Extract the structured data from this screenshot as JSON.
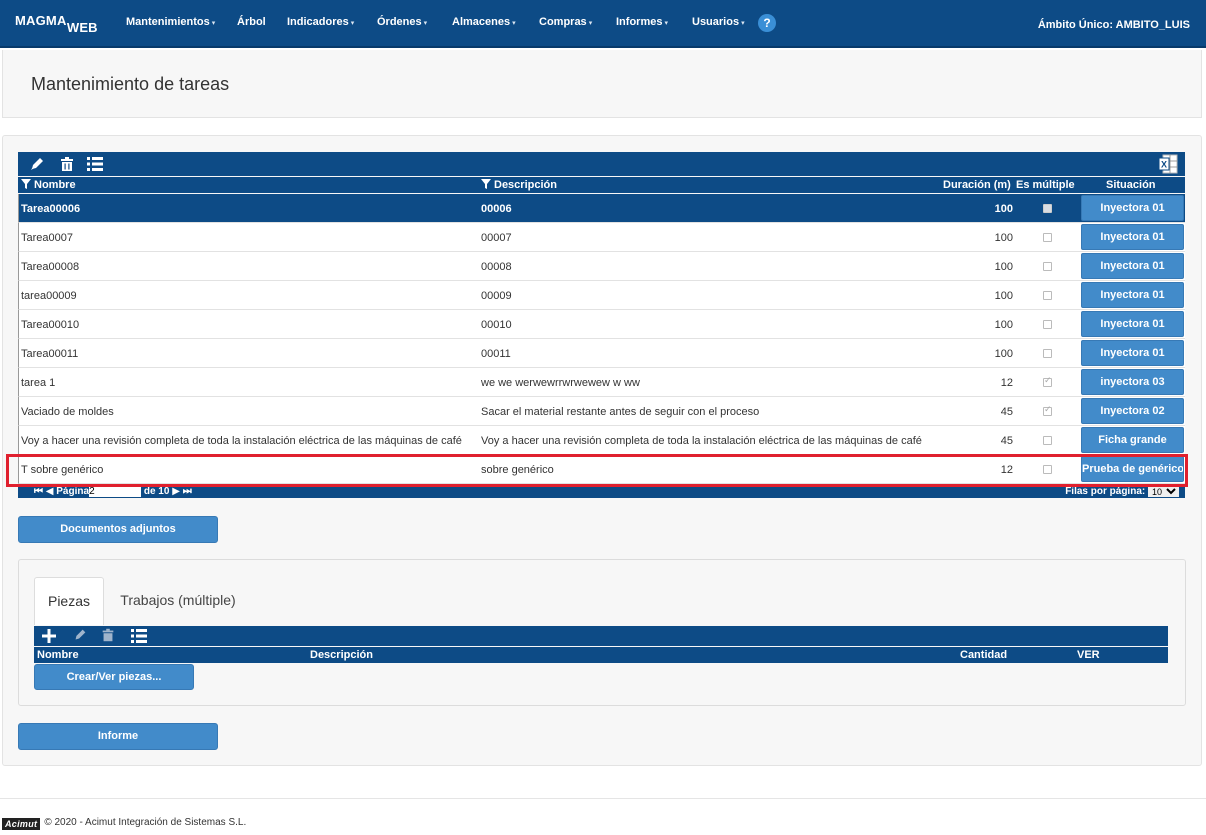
{
  "app": {
    "logo_main": "MAGMA",
    "logo_sub": "WEB",
    "ambito": "Ámbito Único: AMBITO_LUIS"
  },
  "nav": {
    "items": [
      {
        "label": "Mantenimientos",
        "has_caret": true
      },
      {
        "label": "Árbol",
        "has_caret": false
      },
      {
        "label": "Indicadores",
        "has_caret": true
      },
      {
        "label": "Órdenes",
        "has_caret": true
      },
      {
        "label": "Almacenes",
        "has_caret": true
      },
      {
        "label": "Compras",
        "has_caret": true
      },
      {
        "label": "Informes",
        "has_caret": true
      },
      {
        "label": "Usuarios",
        "has_caret": true
      }
    ],
    "help": "?"
  },
  "page": {
    "title": "Mantenimiento de tareas"
  },
  "grid": {
    "toolbar_icons": [
      "edit-icon",
      "trash-icon",
      "list-icon",
      "excel-icon"
    ],
    "columns": {
      "nombre": "Nombre",
      "descripcion": "Descripción",
      "duracion": "Duración (m)",
      "multiple": "Es múltiple",
      "situacion": "Situación"
    },
    "rows": [
      {
        "nombre": "Tarea00006",
        "descripcion": "00006",
        "duracion": "100",
        "multiple": false,
        "situacion": "Inyectora 01",
        "selected": true
      },
      {
        "nombre": "Tarea0007",
        "descripcion": "00007",
        "duracion": "100",
        "multiple": false,
        "situacion": "Inyectora 01",
        "selected": false
      },
      {
        "nombre": "Tarea00008",
        "descripcion": "00008",
        "duracion": "100",
        "multiple": false,
        "situacion": "Inyectora 01",
        "selected": false
      },
      {
        "nombre": "tarea00009",
        "descripcion": "00009",
        "duracion": "100",
        "multiple": false,
        "situacion": "Inyectora 01",
        "selected": false
      },
      {
        "nombre": "Tarea00010",
        "descripcion": "00010",
        "duracion": "100",
        "multiple": false,
        "situacion": "Inyectora 01",
        "selected": false
      },
      {
        "nombre": "Tarea00011",
        "descripcion": "00011",
        "duracion": "100",
        "multiple": false,
        "situacion": "Inyectora 01",
        "selected": false
      },
      {
        "nombre": "tarea 1",
        "descripcion": "we we werwewrrwrwewew w ww",
        "duracion": "12",
        "multiple": true,
        "situacion": "inyectora 03",
        "selected": false
      },
      {
        "nombre": "Vaciado de moldes",
        "descripcion": "Sacar el material restante antes de seguir con el proceso",
        "duracion": "45",
        "multiple": true,
        "situacion": "Inyectora 02",
        "selected": false
      },
      {
        "nombre": "Voy a hacer una revisión completa de toda la instalación eléctrica de las máquinas de café",
        "descripcion": "Voy a hacer una revisión completa de toda la instalación eléctrica de las máquinas de café",
        "duracion": "45",
        "multiple": false,
        "situacion": "Ficha grande",
        "selected": false
      },
      {
        "nombre": "T sobre genérico",
        "descripcion": "sobre genérico",
        "duracion": "12",
        "multiple": false,
        "situacion": "Prueba de genérico",
        "selected": false
      }
    ],
    "pager": {
      "page_label": "Página",
      "page_value": "2",
      "of_label": "de 10",
      "rows_label": "Filas por página:",
      "rows_value": "10"
    }
  },
  "buttons": {
    "documentos": "Documentos adjuntos",
    "crear_piezas": "Crear/Ver piezas...",
    "informe": "Informe"
  },
  "tabs": [
    {
      "label": "Piezas",
      "active": true
    },
    {
      "label": "Trabajos (múltiple)",
      "active": false
    }
  ],
  "sub_grid": {
    "toolbar_icons": [
      "plus-icon",
      "edit-icon",
      "trash-icon",
      "list-icon"
    ],
    "columns": {
      "nombre": "Nombre",
      "descripcion": "Descripción",
      "cantidad": "Cantidad",
      "ver": "VER"
    }
  },
  "footer": {
    "logo": "Acimut",
    "text": "© 2020 - Acimut Integración de Sistemas S.L."
  },
  "colors": {
    "navbar": "#0d4b86",
    "button": "#428bca",
    "highlight": "#e0202e"
  }
}
